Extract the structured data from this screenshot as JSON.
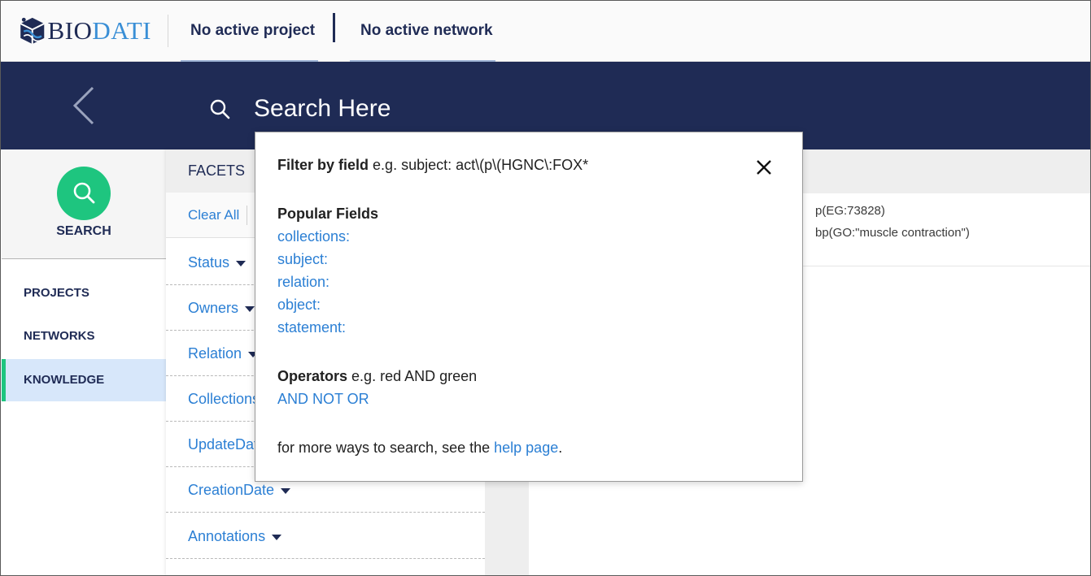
{
  "header": {
    "logo_text_a": "BIO",
    "logo_text_b": "DATI",
    "active_project": "No active project",
    "active_network": "No active network"
  },
  "search": {
    "placeholder": "Search Here"
  },
  "leftnav": {
    "search_label": "SEARCH",
    "items": [
      "PROJECTS",
      "NETWORKS",
      "KNOWLEDGE"
    ],
    "active_item": "KNOWLEDGE"
  },
  "facets": {
    "title": "FACETS",
    "clear_all": "Clear All",
    "items": [
      "Status",
      "Owners",
      "Relation",
      "Collections",
      "UpdateDate",
      "CreationDate",
      "Annotations"
    ]
  },
  "results": {
    "row1": {
      "subject": "p(EG:73828)",
      "object": "bp(GO:\"muscle contraction\")"
    }
  },
  "help_popover": {
    "filter_label": "Filter by field",
    "filter_example": "e.g. subject: act\\(p\\(HGNC\\:FOX*",
    "popular_fields_label": "Popular Fields",
    "popular_fields": [
      "collections:",
      "subject:",
      "relation:",
      "object:",
      "statement:"
    ],
    "operators_label": "Operators",
    "operators_example": "e.g. red AND green",
    "operators": "AND NOT OR",
    "footer_prefix": "for more ways to search, see the",
    "footer_link": "help page",
    "footer_suffix": "."
  },
  "colors": {
    "navy": "#1f2b55",
    "accent_green": "#1ec57f",
    "link_blue": "#2b7fd4"
  }
}
